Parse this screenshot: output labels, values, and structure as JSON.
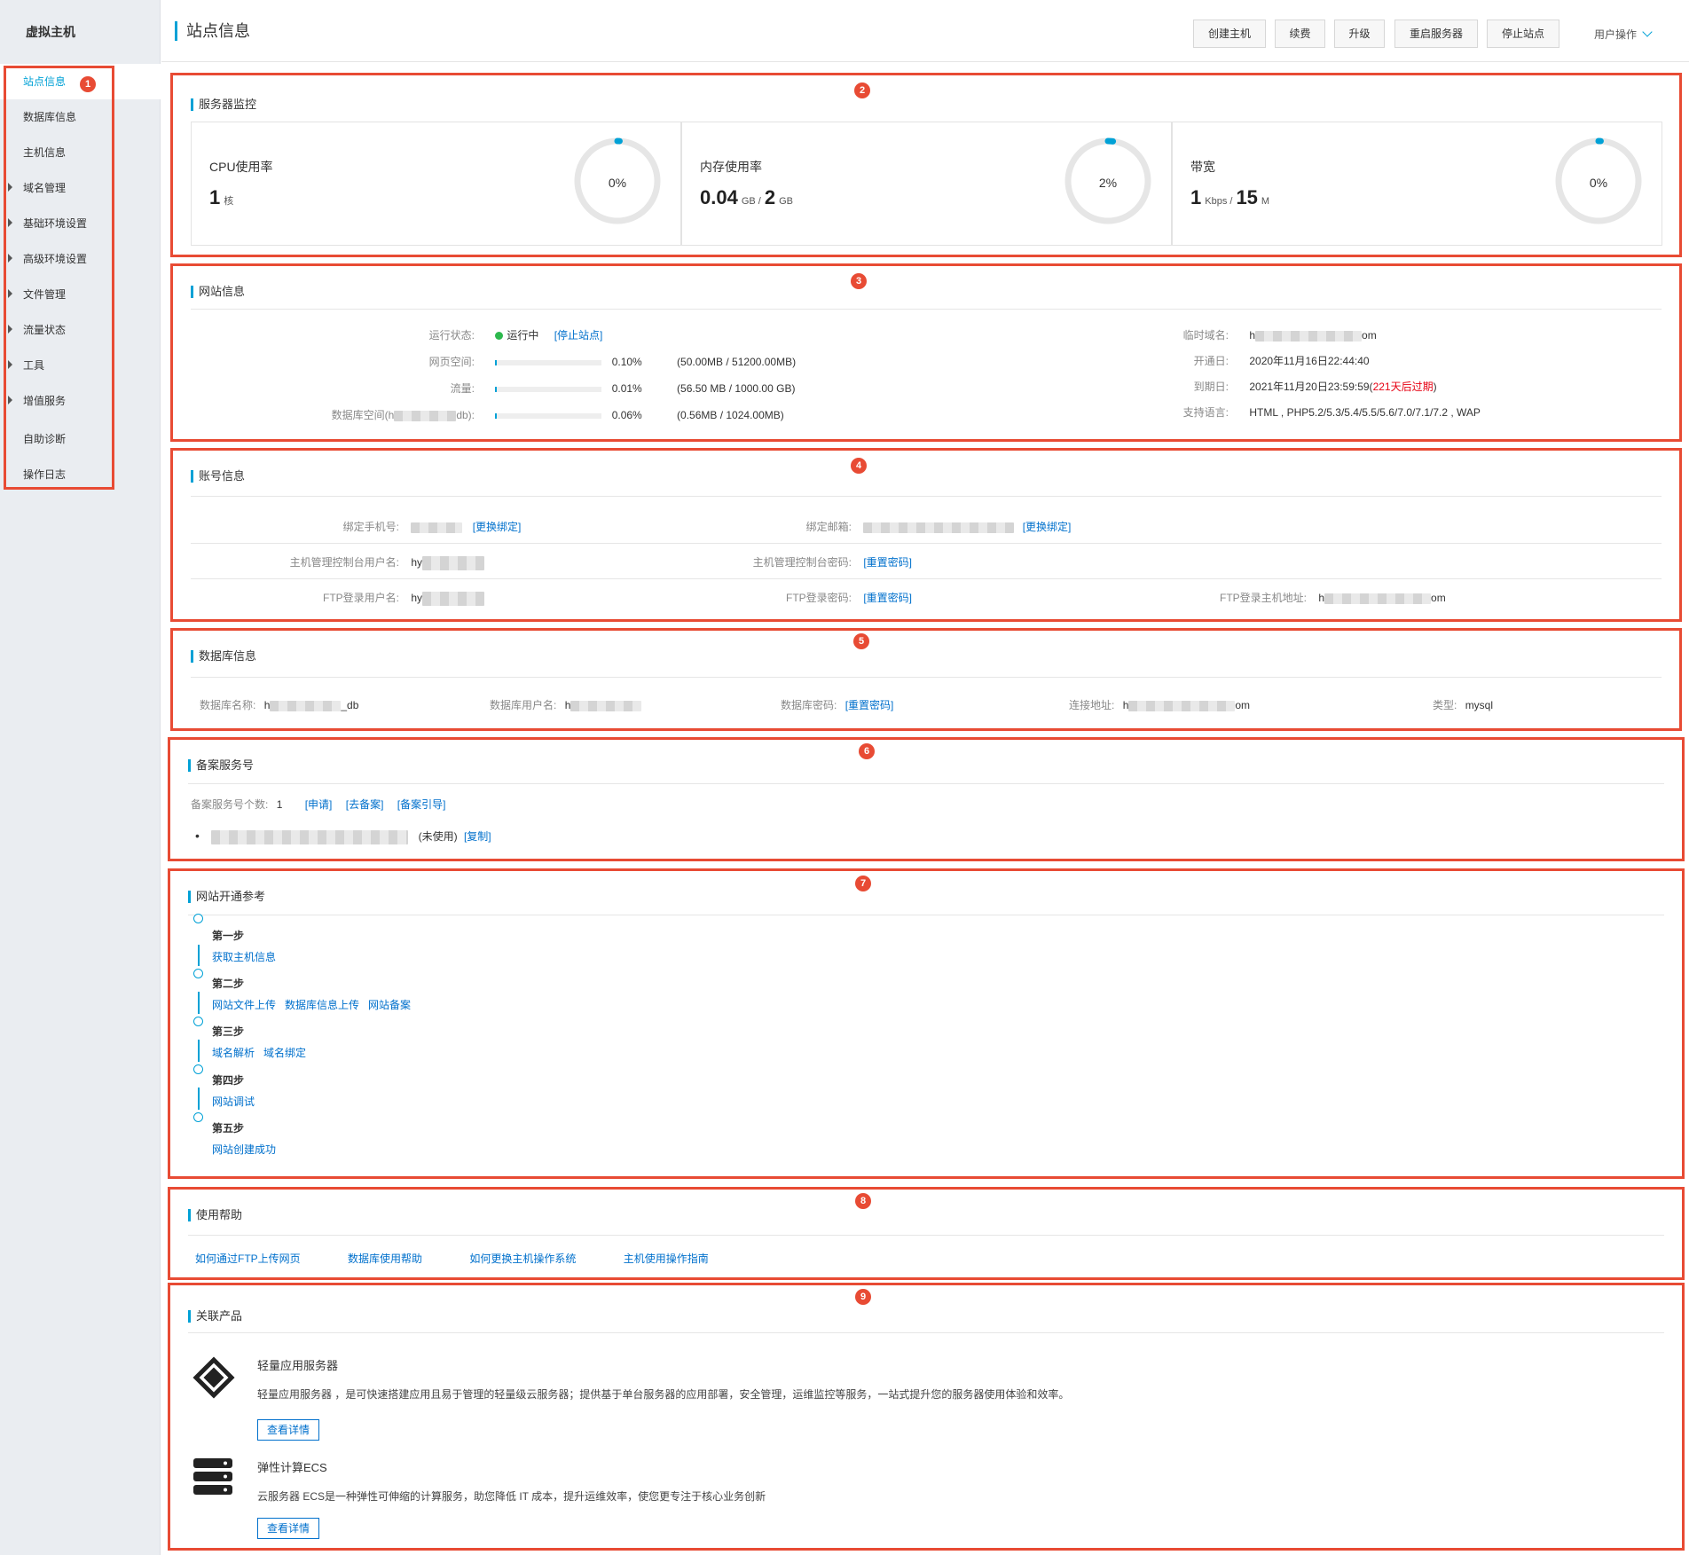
{
  "sidebar": {
    "title": "虚拟主机",
    "items": [
      {
        "label": "站点信息"
      },
      {
        "label": "数据库信息"
      },
      {
        "label": "主机信息"
      },
      {
        "label": "域名管理"
      },
      {
        "label": "基础环境设置"
      },
      {
        "label": "高级环境设置"
      },
      {
        "label": "文件管理"
      },
      {
        "label": "流量状态"
      },
      {
        "label": "工具"
      },
      {
        "label": "增值服务"
      },
      {
        "label": "自助诊断"
      },
      {
        "label": "操作日志"
      }
    ]
  },
  "badges": [
    "1",
    "2",
    "3",
    "4",
    "5",
    "6",
    "7",
    "8",
    "9"
  ],
  "header": {
    "title": "站点信息",
    "buttons": [
      "创建主机",
      "续费",
      "升级",
      "重启服务器",
      "停止站点"
    ],
    "user_ops": "用户操作"
  },
  "monitor": {
    "title": "服务器监控",
    "cpu": {
      "label": "CPU使用率",
      "value": "1",
      "unit": "核",
      "percent_text": "0%",
      "percent": 0
    },
    "mem": {
      "label": "内存使用率",
      "used": "0.04",
      "used_unit": "GB /",
      "total": "2",
      "total_unit": "GB",
      "percent_text": "2%",
      "percent": 2
    },
    "bw": {
      "label": "带宽",
      "used": "1",
      "used_unit": "Kbps /",
      "total": "15",
      "total_unit": "M",
      "percent_text": "0%",
      "percent": 0
    }
  },
  "site": {
    "title": "网站信息",
    "status_label": "运行状态:",
    "status_value": "运行中",
    "status_action": "[停止站点]",
    "web_label": "网页空间:",
    "web_pct": "0.10%",
    "web_detail": "(50.00MB / 51200.00MB)",
    "web_fill": 0.1,
    "traffic_label": "流量:",
    "traffic_pct": "0.01%",
    "traffic_detail": "(56.50 MB / 1000.00 GB)",
    "traffic_fill": 0.01,
    "db_label_a": "数据库空间(h",
    "db_label_b": "db):",
    "db_pct": "0.06%",
    "db_detail": "(0.56MB / 1024.00MB)",
    "db_fill": 0.06,
    "tmp_domain_label": "临时域名:",
    "tmp_domain_a": "h",
    "tmp_domain_b": "om",
    "open_label": "开通日:",
    "open_value": "2020年11月16日22:44:40",
    "expire_label": "到期日:",
    "expire_value": "2021年11月20日23:59:59(",
    "expire_warn": "221天后过期",
    "expire_close": ")",
    "lang_label": "支持语言:",
    "lang_value": "HTML , PHP5.2/5.3/5.4/5.5/5.6/7.0/7.1/7.2 , WAP"
  },
  "account": {
    "title": "账号信息",
    "phone_label": "绑定手机号:",
    "phone_action": "[更换绑定]",
    "email_label": "绑定邮箱:",
    "email_action": "[更换绑定]",
    "console_user_label": "主机管理控制台用户名:",
    "console_user_a": "hy",
    "console_pwd_label": "主机管理控制台密码:",
    "console_pwd_action": "[重置密码]",
    "ftp_user_label": "FTP登录用户名:",
    "ftp_user_a": "hy",
    "ftp_pwd_label": "FTP登录密码:",
    "ftp_pwd_action": "[重置密码]",
    "ftp_host_label": "FTP登录主机地址:",
    "ftp_host_a": "h",
    "ftp_host_b": "om"
  },
  "database": {
    "title": "数据库信息",
    "name_label": "数据库名称:",
    "name_a": "h",
    "name_b": "_db",
    "user_label": "数据库用户名:",
    "user_a": "h",
    "pwd_label": "数据库密码:",
    "pwd_action": "[重置密码]",
    "host_label": "连接地址:",
    "host_a": "h",
    "host_b": "om",
    "type_label": "类型:",
    "type_value": "mysql"
  },
  "beian": {
    "title": "备案服务号",
    "count_label": "备案服务号个数:",
    "count_value": "1",
    "actions": [
      "[申请]",
      "[去备案]",
      "[备案引导]"
    ],
    "item_status": "(未使用)",
    "item_action": "[复制]"
  },
  "steps": {
    "title": "网站开通参考",
    "list": [
      {
        "name": "第一步",
        "links": [
          "获取主机信息"
        ]
      },
      {
        "name": "第二步",
        "links": [
          "网站文件上传",
          "数据库信息上传",
          "网站备案"
        ]
      },
      {
        "name": "第三步",
        "links": [
          "域名解析",
          "域名绑定"
        ]
      },
      {
        "name": "第四步",
        "links": [
          "网站调试"
        ]
      },
      {
        "name": "第五步",
        "links": [
          "网站创建成功"
        ]
      }
    ]
  },
  "help": {
    "title": "使用帮助",
    "links": [
      "如何通过FTP上传网页",
      "数据库使用帮助",
      "如何更换主机操作系统",
      "主机使用操作指南"
    ]
  },
  "products": {
    "title": "关联产品",
    "items": [
      {
        "name": "轻量应用服务器",
        "desc": "轻量应用服务器 ，是可快速搭建应用且易于管理的轻量级云服务器；提供基于单台服务器的应用部署，安全管理，运维监控等服务，一站式提升您的服务器使用体验和效率。",
        "button": "查看详情",
        "icon": "cube-logo-icon"
      },
      {
        "name": "弹性计算ECS",
        "desc": "云服务器 ECS是一种弹性可伸缩的计算服务，助您降低 IT 成本，提升运维效率，使您更专注于核心业务创新",
        "button": "查看详情",
        "icon": "server-stack-icon"
      }
    ]
  },
  "colors": {
    "accent": "#00a1d6",
    "highlight_border": "#e84b34",
    "link": "#0070cc",
    "running": "#2db84d",
    "warning": "#e60012"
  }
}
